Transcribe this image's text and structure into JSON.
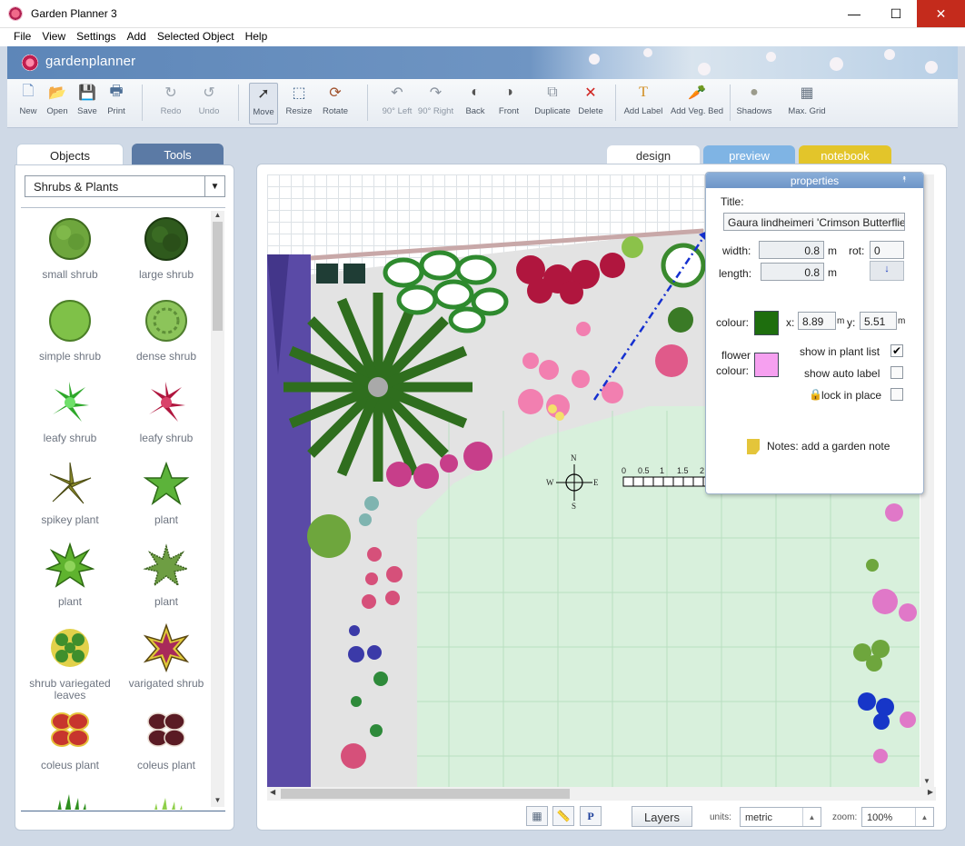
{
  "window": {
    "title": "Garden Planner 3",
    "minimize": "—",
    "maximize": "☐",
    "close": "✕"
  },
  "menu": [
    "File",
    "View",
    "Settings",
    "Add",
    "Selected Object",
    "Help"
  ],
  "brand": "gardenplanner",
  "toolbar": [
    {
      "label": "New",
      "icon": "new-icon",
      "glyph": "🗋"
    },
    {
      "label": "Open",
      "icon": "open-icon",
      "glyph": "📂"
    },
    {
      "label": "Save",
      "icon": "save-icon",
      "glyph": "💾"
    },
    {
      "label": "Print",
      "icon": "print-icon",
      "glyph": "🖶"
    },
    {
      "label": "Redo",
      "icon": "redo-icon",
      "glyph": "↻"
    },
    {
      "label": "Undo",
      "icon": "undo-icon",
      "glyph": "↺"
    },
    {
      "label": "Move",
      "icon": "move-icon",
      "glyph": "➚"
    },
    {
      "label": "Resize",
      "icon": "resize-icon",
      "glyph": "⬚"
    },
    {
      "label": "Rotate",
      "icon": "rotate-icon",
      "glyph": "⟳"
    },
    {
      "label": "90° Left",
      "icon": "rotate-left-icon",
      "glyph": "↶"
    },
    {
      "label": "90° Right",
      "icon": "rotate-right-icon",
      "glyph": "↷"
    },
    {
      "label": "Back",
      "icon": "send-back-icon",
      "glyph": "◐"
    },
    {
      "label": "Front",
      "icon": "bring-front-icon",
      "glyph": "◑"
    },
    {
      "label": "Duplicate",
      "icon": "duplicate-icon",
      "glyph": "⧉"
    },
    {
      "label": "Delete",
      "icon": "delete-icon",
      "glyph": "✕"
    },
    {
      "label": "Add Label",
      "icon": "add-label-icon",
      "glyph": "T"
    },
    {
      "label": "Add Veg. Bed",
      "icon": "add-veg-bed-icon",
      "glyph": "🥕"
    },
    {
      "label": "Shadows",
      "icon": "shadows-icon",
      "glyph": "●"
    },
    {
      "label": "Max. Grid",
      "icon": "max-grid-icon",
      "glyph": "▦"
    }
  ],
  "left_tabs": {
    "objects": "Objects",
    "tools": "Tools"
  },
  "category": {
    "selected": "Shrubs & Plants"
  },
  "objects": [
    "small shrub",
    "large shrub",
    "simple shrub",
    "dense shrub",
    "leafy shrub",
    "leafy shrub",
    "spikey plant",
    "plant",
    "plant",
    "plant",
    "shrub variegated leaves",
    "varigated shrub",
    "coleus plant",
    "coleus plant",
    "",
    ""
  ],
  "main_tabs": {
    "design": "design",
    "preview": "preview",
    "notebook": "notebook"
  },
  "properties": {
    "header": "properties",
    "title_label": "Title:",
    "title_value": "Gaura lindheimeri 'Crimson Butterflies'",
    "width_label": "width:",
    "width_value": "0.8",
    "width_unit": "m",
    "length_label": "length:",
    "length_value": "0.8",
    "length_unit": "m",
    "rot_label": "rot:",
    "rot_value": "0",
    "colour_label": "colour:",
    "colour_value": "#1e6e0e",
    "x_label": "x:",
    "x_value": "8.89",
    "x_unit": "m",
    "y_label": "y:",
    "y_value": "5.51",
    "y_unit": "m",
    "flower_label": "flower",
    "flower_colour_label": "colour:",
    "flower_colour_value": "#f6a0f0",
    "show_in_plant_list": "show in plant list",
    "show_in_plant_list_checked": true,
    "show_auto_label": "show auto label",
    "show_auto_label_checked": false,
    "lock_in_place": "lock in place",
    "lock_in_place_checked": false,
    "notes": "Notes: add a garden note"
  },
  "canvas": {
    "compass": {
      "n": "N",
      "s": "S",
      "e": "E",
      "w": "W"
    },
    "scale_labels": [
      "0",
      "0.5",
      "1",
      "1.5",
      "2"
    ]
  },
  "statusbar": {
    "layers": "Layers",
    "units_label": "units:",
    "units_value": "metric",
    "zoom_label": "zoom:",
    "zoom_value": "100%"
  }
}
